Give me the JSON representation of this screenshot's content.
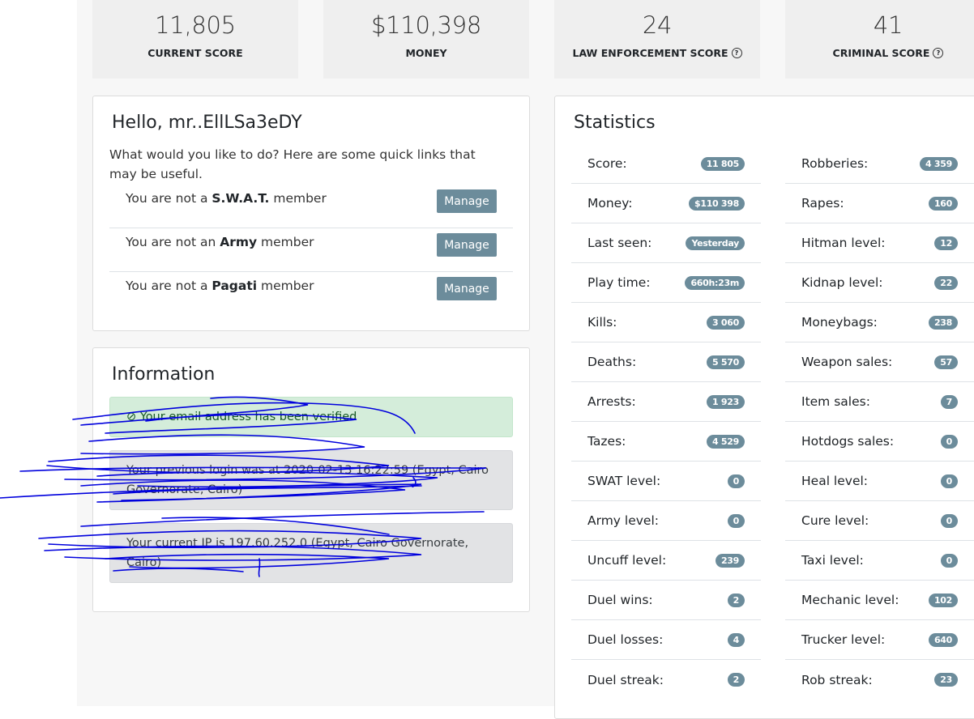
{
  "top_cards": [
    {
      "value": "11,805",
      "label": "CURRENT SCORE",
      "help": false
    },
    {
      "value": "$110,398",
      "label": "MONEY",
      "help": false
    },
    {
      "value": "24",
      "label": "LAW ENFORCEMENT SCORE",
      "help": true
    },
    {
      "value": "41",
      "label": "CRIMINAL SCORE",
      "help": true
    }
  ],
  "help_glyph": "?",
  "hello": {
    "title": "Hello, mr..EllLSa3eDY",
    "text": "What would you like to do? Here are some quick links that may be useful.",
    "members": [
      {
        "prefix": "You are not a ",
        "group": "S.W.A.T.",
        "suffix": " member",
        "button": "Manage"
      },
      {
        "prefix": "You are not an ",
        "group": "Army",
        "suffix": " member",
        "button": "Manage"
      },
      {
        "prefix": "You are not a ",
        "group": "Pagati",
        "suffix": " member",
        "button": "Manage"
      }
    ]
  },
  "information": {
    "title": "Information",
    "alerts": [
      {
        "type": "success",
        "text": "⊘ Your email address has been verified"
      },
      {
        "type": "secondary",
        "text": "Your previous login was at 2020-02-13 16:22:59 (Egypt, Cairo Governorate, Cairo)"
      },
      {
        "type": "secondary",
        "text": "Your current IP is 197.60.252.0 (Egypt, Cairo Governorate, Cairo)"
      }
    ]
  },
  "statistics": {
    "title": "Statistics",
    "left": [
      {
        "name": "Score:",
        "value": "11 805"
      },
      {
        "name": "Money:",
        "value": "$110 398"
      },
      {
        "name": "Last seen:",
        "value": "Yesterday"
      },
      {
        "name": "Play time:",
        "value": "660h:23m"
      },
      {
        "name": "Kills:",
        "value": "3 060"
      },
      {
        "name": "Deaths:",
        "value": "5 570"
      },
      {
        "name": "Arrests:",
        "value": "1 923"
      },
      {
        "name": "Tazes:",
        "value": "4 529"
      },
      {
        "name": "SWAT level:",
        "value": "0"
      },
      {
        "name": "Army level:",
        "value": "0"
      },
      {
        "name": "Uncuff level:",
        "value": "239"
      },
      {
        "name": "Duel wins:",
        "value": "2"
      },
      {
        "name": "Duel losses:",
        "value": "4"
      },
      {
        "name": "Duel streak:",
        "value": "2"
      }
    ],
    "right": [
      {
        "name": "Robberies:",
        "value": "4 359"
      },
      {
        "name": "Rapes:",
        "value": "160"
      },
      {
        "name": "Hitman level:",
        "value": "12"
      },
      {
        "name": "Kidnap level:",
        "value": "22"
      },
      {
        "name": "Moneybags:",
        "value": "238"
      },
      {
        "name": "Weapon sales:",
        "value": "57"
      },
      {
        "name": "Item sales:",
        "value": "7"
      },
      {
        "name": "Hotdogs sales:",
        "value": "0"
      },
      {
        "name": "Heal level:",
        "value": "0"
      },
      {
        "name": "Cure level:",
        "value": "0"
      },
      {
        "name": "Taxi level:",
        "value": "0"
      },
      {
        "name": "Mechanic level:",
        "value": "102"
      },
      {
        "name": "Trucker level:",
        "value": "640"
      },
      {
        "name": "Rob streak:",
        "value": "23"
      }
    ]
  },
  "colors": {
    "badge": "#6c8c9b",
    "button": "#6c8c9b",
    "scribble": "#0000dd"
  }
}
